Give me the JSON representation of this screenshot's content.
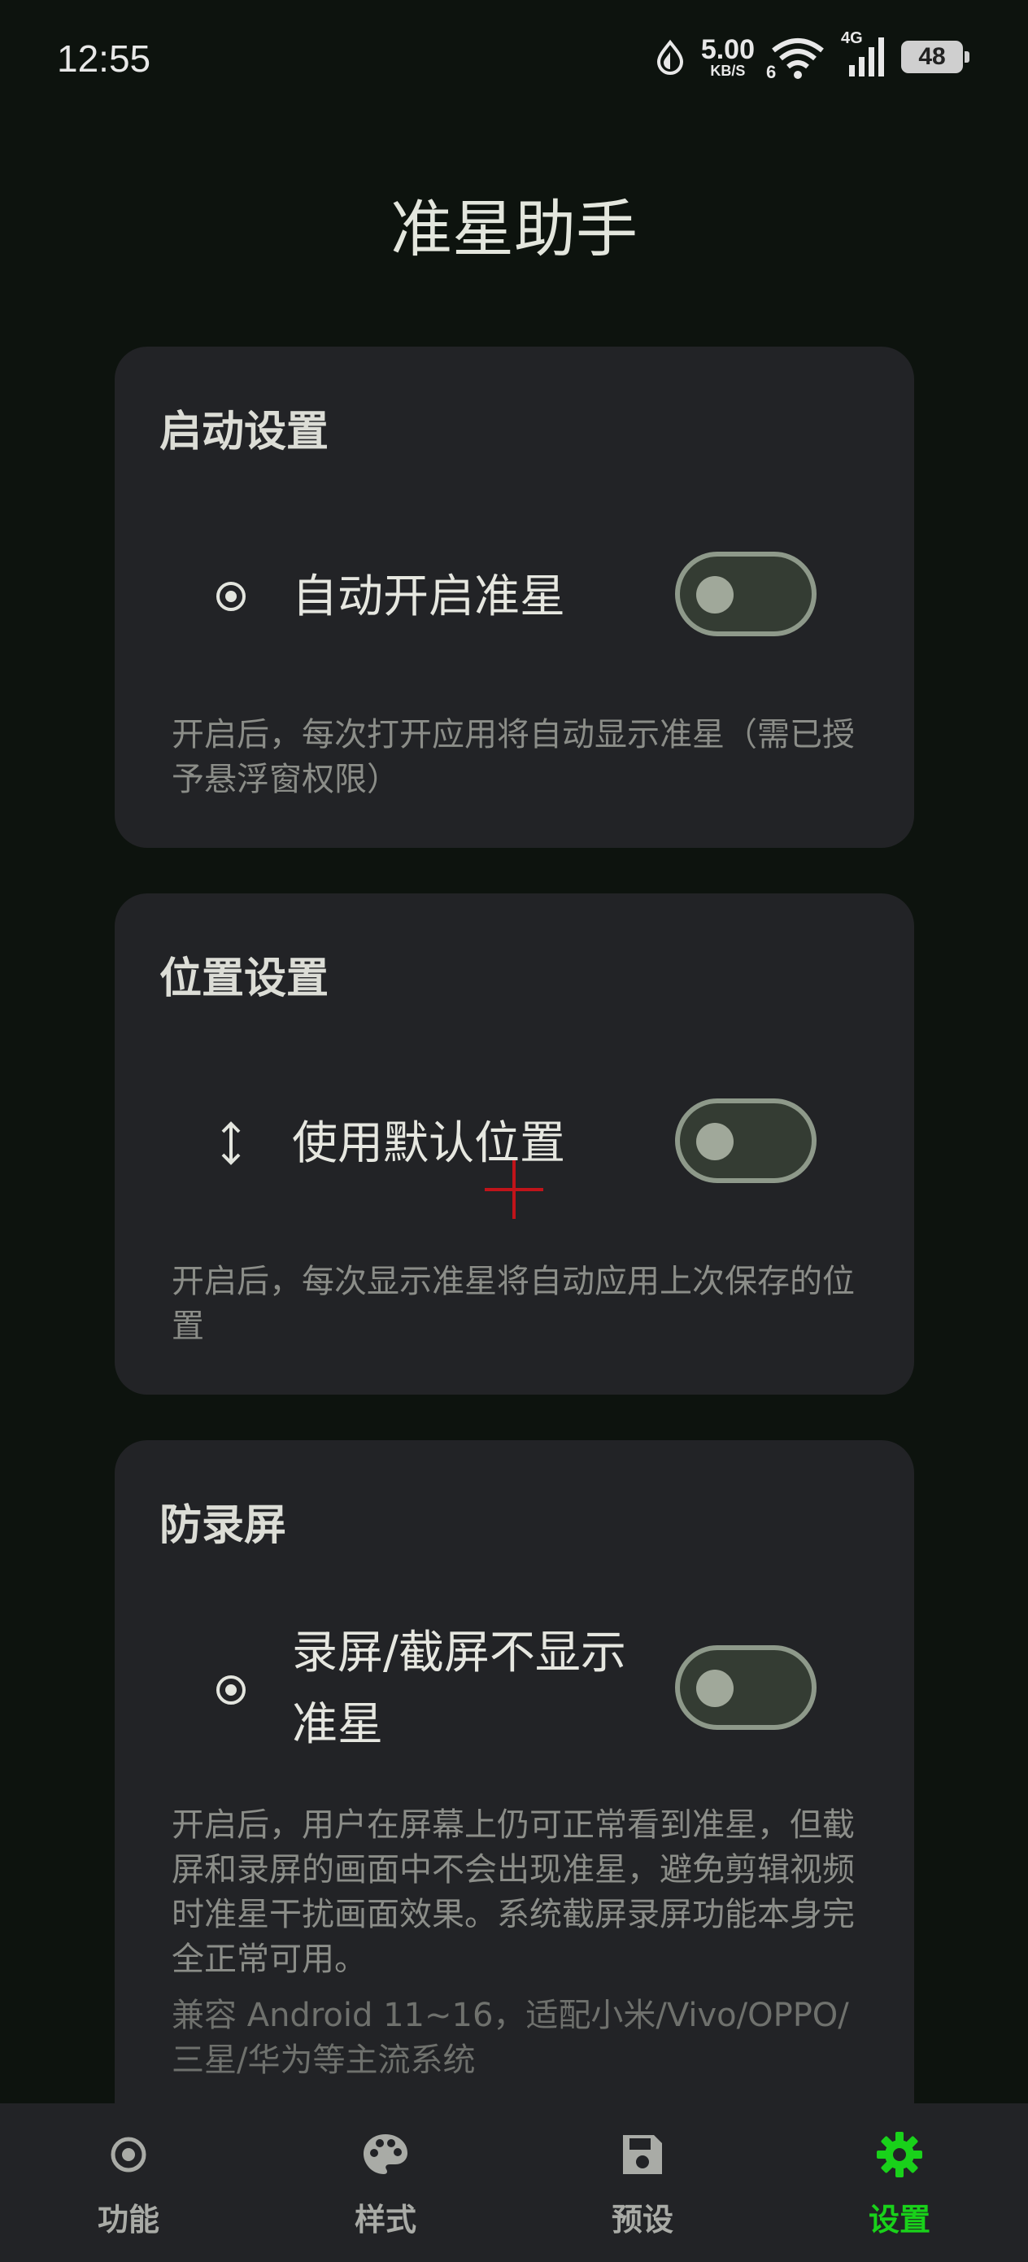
{
  "status_bar": {
    "time": "12:55",
    "net_speed": "5.00",
    "net_speed_unit": "KB/S",
    "wifi_label": "6",
    "cell_label": "4G",
    "battery": "48"
  },
  "page_title": "准星助手",
  "cards": [
    {
      "title": "启动设置",
      "label": "自动开启准星",
      "icon": "radio-target-icon",
      "toggle_on": false,
      "desc": "开启后，每次打开应用将自动显示准星（需已授予悬浮窗权限）"
    },
    {
      "title": "位置设置",
      "label": "使用默认位置",
      "icon": "vertical-arrows-icon",
      "toggle_on": false,
      "desc": "开启后，每次显示准星将自动应用上次保存的位置"
    },
    {
      "title": "防录屏",
      "label": "录屏/截屏不显示准星",
      "icon": "radio-target-icon",
      "toggle_on": false,
      "desc": "开启后，用户在屏幕上仍可正常看到准星，但截屏和录屏的画面中不会出现准星，避免剪辑视频时准星干扰画面效果。系统截屏录屏功能本身完全正常可用。",
      "desc2": "兼容 Android 11~16，适配小米/Vivo/OPPO/三星/华为等主流系统"
    }
  ],
  "bottom_nav": [
    {
      "label": "功能",
      "icon": "target-icon",
      "active": false
    },
    {
      "label": "样式",
      "icon": "palette-icon",
      "active": false
    },
    {
      "label": "预设",
      "icon": "save-icon",
      "active": false
    },
    {
      "label": "设置",
      "icon": "gear-icon",
      "active": true
    }
  ],
  "colors": {
    "background": "#0d130e",
    "card": "#222326",
    "accent": "#19d11a",
    "crosshair": "#c0141a"
  }
}
